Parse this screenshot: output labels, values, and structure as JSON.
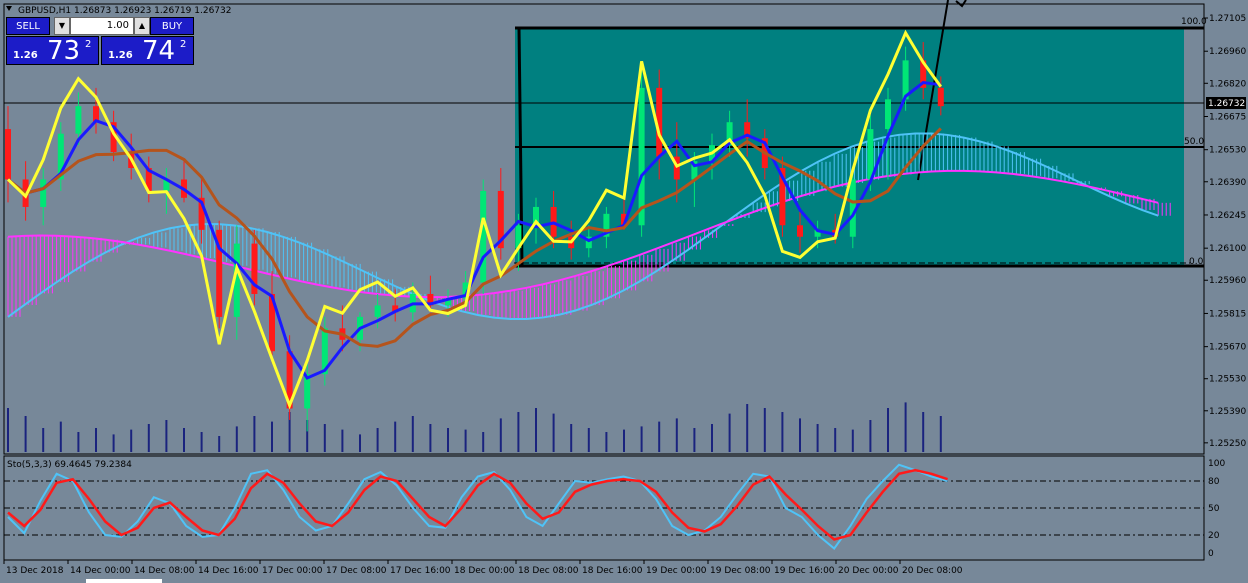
{
  "header": {
    "symbol_info": "GBPUSD,H1  1.26873 1.26923 1.26719 1.26732"
  },
  "trade_panel": {
    "sell_label": "SELL",
    "buy_label": "BUY",
    "lot_value": "1.00",
    "down_icon": "triangle-down-icon",
    "up_icon": "triangle-up-icon",
    "sell_small": "1.26",
    "sell_big": "73",
    "sell_sup": "2",
    "buy_small": "1.26",
    "buy_big": "74",
    "buy_sup": "2"
  },
  "stoch": {
    "info": "Sto(5,3,3) 69.4645 79.2384",
    "levels": [
      "100",
      "80",
      "50",
      "20",
      "0"
    ]
  },
  "fibo": {
    "top_label": "100.0",
    "mid_label": "50.0",
    "bottom_label": "0.0"
  },
  "price_tag": "1.26732",
  "colors": {
    "background": "#778899",
    "box": "#008080",
    "bull": "#00e676",
    "bear": "#ff1a1a",
    "tenkan": "#1a1aff",
    "kijun": "#b5541c",
    "senkou_a": "#4fc3f7",
    "senkou_b": "#ff33ff",
    "chikou": "#ffff33",
    "volume": "#1a237e",
    "stoch_main": "#4fc3f7",
    "stoch_signal": "#ff1a1a"
  },
  "chart_data": {
    "type": "candlestick",
    "timeframe": "H1",
    "y_ticks": [
      "1.27105",
      "1.26960",
      "1.26820",
      "1.26675",
      "1.26530",
      "1.26390",
      "1.26245",
      "1.26100",
      "1.25960",
      "1.25815",
      "1.25670",
      "1.25530",
      "1.25390",
      "1.25250"
    ],
    "ylim": [
      1.2521,
      1.2714
    ],
    "x_ticks": [
      "13 Dec 2018",
      "14 Dec 00:00",
      "14 Dec 08:00",
      "14 Dec 16:00",
      "17 Dec 00:00",
      "17 Dec 08:00",
      "17 Dec 16:00",
      "18 Dec 00:00",
      "18 Dec 08:00",
      "18 Dec 16:00",
      "19 Dec 00:00",
      "19 Dec 08:00",
      "19 Dec 16:00",
      "20 Dec 00:00",
      "20 Dec 08:00"
    ],
    "candles": [
      [
        1.2662,
        1.2672,
        1.263,
        1.264
      ],
      [
        1.264,
        1.2648,
        1.2622,
        1.2628
      ],
      [
        1.2628,
        1.2645,
        1.262,
        1.264
      ],
      [
        1.264,
        1.2665,
        1.2635,
        1.266
      ],
      [
        1.266,
        1.2678,
        1.2655,
        1.2672
      ],
      [
        1.2672,
        1.268,
        1.266,
        1.2665
      ],
      [
        1.2665,
        1.267,
        1.2648,
        1.2652
      ],
      [
        1.2652,
        1.266,
        1.264,
        1.2645
      ],
      [
        1.2645,
        1.265,
        1.263,
        1.2635
      ],
      [
        1.2635,
        1.2645,
        1.2625,
        1.264
      ],
      [
        1.264,
        1.2648,
        1.263,
        1.2632
      ],
      [
        1.2632,
        1.264,
        1.2612,
        1.2618
      ],
      [
        1.2618,
        1.2622,
        1.2575,
        1.258
      ],
      [
        1.258,
        1.262,
        1.257,
        1.2612
      ],
      [
        1.2612,
        1.2618,
        1.2585,
        1.259
      ],
      [
        1.259,
        1.26,
        1.256,
        1.2565
      ],
      [
        1.2565,
        1.2572,
        1.2535,
        1.254
      ],
      [
        1.254,
        1.256,
        1.253,
        1.2555
      ],
      [
        1.2555,
        1.258,
        1.255,
        1.2575
      ],
      [
        1.2575,
        1.2585,
        1.2565,
        1.257
      ],
      [
        1.257,
        1.2582,
        1.2565,
        1.258
      ],
      [
        1.258,
        1.259,
        1.2575,
        1.2585
      ],
      [
        1.2585,
        1.2592,
        1.2578,
        1.2582
      ],
      [
        1.2582,
        1.2595,
        1.2578,
        1.259
      ],
      [
        1.259,
        1.2598,
        1.2582,
        1.2585
      ],
      [
        1.2585,
        1.2592,
        1.258,
        1.2588
      ],
      [
        1.2588,
        1.26,
        1.2585,
        1.2595
      ],
      [
        1.2595,
        1.264,
        1.259,
        1.2635
      ],
      [
        1.2635,
        1.2645,
        1.2605,
        1.261
      ],
      [
        1.261,
        1.2625,
        1.26,
        1.262
      ],
      [
        1.262,
        1.2632,
        1.2612,
        1.2628
      ],
      [
        1.2628,
        1.2635,
        1.261,
        1.2615
      ],
      [
        1.2615,
        1.2622,
        1.2605,
        1.261
      ],
      [
        1.261,
        1.262,
        1.2606,
        1.2615
      ],
      [
        1.2615,
        1.2628,
        1.261,
        1.2625
      ],
      [
        1.2625,
        1.2632,
        1.2618,
        1.262
      ],
      [
        1.262,
        1.269,
        1.2615,
        1.268
      ],
      [
        1.268,
        1.2688,
        1.264,
        1.265
      ],
      [
        1.265,
        1.2665,
        1.263,
        1.264
      ],
      [
        1.264,
        1.2652,
        1.2628,
        1.2648
      ],
      [
        1.2648,
        1.266,
        1.264,
        1.2655
      ],
      [
        1.2655,
        1.267,
        1.265,
        1.2665
      ],
      [
        1.2665,
        1.2675,
        1.265,
        1.2658
      ],
      [
        1.2658,
        1.2662,
        1.264,
        1.2645
      ],
      [
        1.2645,
        1.265,
        1.2615,
        1.262
      ],
      [
        1.262,
        1.2628,
        1.2608,
        1.2615
      ],
      [
        1.2615,
        1.2622,
        1.261,
        1.2618
      ],
      [
        1.2618,
        1.2625,
        1.2612,
        1.2615
      ],
      [
        1.2615,
        1.2645,
        1.261,
        1.264
      ],
      [
        1.264,
        1.2668,
        1.2635,
        1.2662
      ],
      [
        1.2662,
        1.268,
        1.264,
        1.2675
      ],
      [
        1.2675,
        1.2698,
        1.267,
        1.2692
      ],
      [
        1.2692,
        1.27,
        1.2675,
        1.268
      ],
      [
        1.268,
        1.2685,
        1.2668,
        1.2672
      ]
    ],
    "volume": [
      0.55,
      0.45,
      0.3,
      0.38,
      0.25,
      0.3,
      0.22,
      0.28,
      0.35,
      0.4,
      0.3,
      0.25,
      0.2,
      0.32,
      0.45,
      0.38,
      0.5,
      0.4,
      0.35,
      0.28,
      0.22,
      0.3,
      0.38,
      0.45,
      0.35,
      0.3,
      0.28,
      0.25,
      0.42,
      0.5,
      0.55,
      0.48,
      0.35,
      0.3,
      0.25,
      0.28,
      0.32,
      0.38,
      0.42,
      0.3,
      0.35,
      0.48,
      0.6,
      0.55,
      0.5,
      0.42,
      0.35,
      0.3,
      0.28,
      0.4,
      0.55,
      0.62,
      0.5,
      0.45
    ],
    "stoch_main": [
      40,
      22,
      58,
      88,
      80,
      45,
      20,
      18,
      35,
      62,
      55,
      30,
      18,
      20,
      50,
      88,
      92,
      70,
      40,
      25,
      30,
      55,
      82,
      90,
      75,
      50,
      30,
      28,
      62,
      85,
      90,
      70,
      40,
      30,
      55,
      80,
      78,
      82,
      85,
      80,
      60,
      30,
      20,
      25,
      40,
      65,
      88,
      85,
      50,
      40,
      20,
      5,
      30,
      60,
      80,
      98,
      92,
      85,
      80
    ],
    "stoch_signal": [
      45,
      30,
      48,
      78,
      82,
      60,
      35,
      20,
      28,
      50,
      56,
      40,
      25,
      20,
      38,
      72,
      88,
      78,
      55,
      35,
      30,
      45,
      70,
      85,
      80,
      60,
      40,
      30,
      50,
      75,
      88,
      78,
      55,
      38,
      45,
      68,
      76,
      80,
      82,
      80,
      68,
      45,
      28,
      24,
      32,
      52,
      76,
      85,
      65,
      48,
      30,
      15,
      20,
      45,
      68,
      88,
      92,
      88,
      82
    ]
  }
}
